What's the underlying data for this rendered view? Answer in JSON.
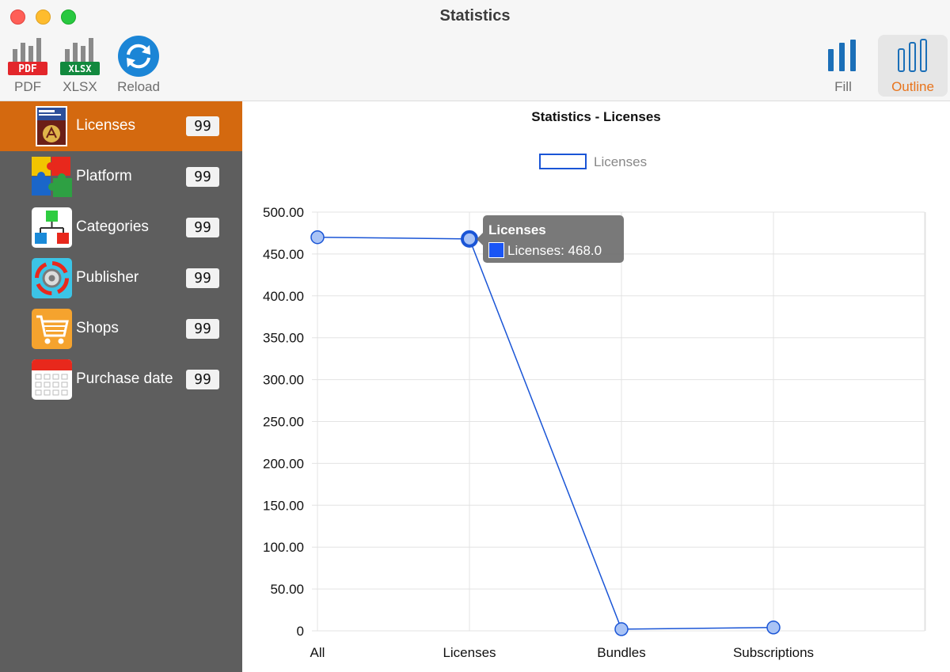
{
  "window": {
    "title": "Statistics"
  },
  "toolbar": {
    "pdf_label": "PDF",
    "pdf_badge": "PDF",
    "xlsx_label": "XLSX",
    "xlsx_badge": "XLSX",
    "reload_label": "Reload",
    "fill_label": "Fill",
    "outline_label": "Outline",
    "selected_view": "Outline"
  },
  "sidebar": {
    "items": [
      {
        "label": "Licenses",
        "count": "99",
        "icon": "license-manager-icon",
        "selected": true
      },
      {
        "label": "Platform",
        "count": "99",
        "icon": "puzzle-icon",
        "selected": false
      },
      {
        "label": "Categories",
        "count": "99",
        "icon": "hierarchy-icon",
        "selected": false
      },
      {
        "label": "Publisher",
        "count": "99",
        "icon": "gear-icon",
        "selected": false
      },
      {
        "label": "Shops",
        "count": "99",
        "icon": "cart-icon",
        "selected": false
      },
      {
        "label": "Purchase date",
        "count": "99",
        "icon": "calendar-icon",
        "selected": false
      }
    ]
  },
  "colors": {
    "accent": "#d4690f",
    "series": "#1a55d6",
    "sidebar": "#5e5e5e"
  },
  "tooltip": {
    "title": "Licenses",
    "line": "Licenses: 468.0"
  },
  "chart_data": {
    "type": "line",
    "title": "Statistics - Licenses",
    "categories": [
      "All",
      "Licenses",
      "Bundles",
      "Subscriptions"
    ],
    "series": [
      {
        "name": "Licenses",
        "values": [
          470,
          468,
          2,
          4
        ]
      }
    ],
    "ylim": [
      0,
      500
    ],
    "yticks": [
      "0",
      "50.00",
      "100.00",
      "150.00",
      "200.00",
      "250.00",
      "300.00",
      "350.00",
      "400.00",
      "450.00",
      "500.00"
    ],
    "grid": true,
    "legend": "top-center",
    "highlighted_index": 1
  }
}
